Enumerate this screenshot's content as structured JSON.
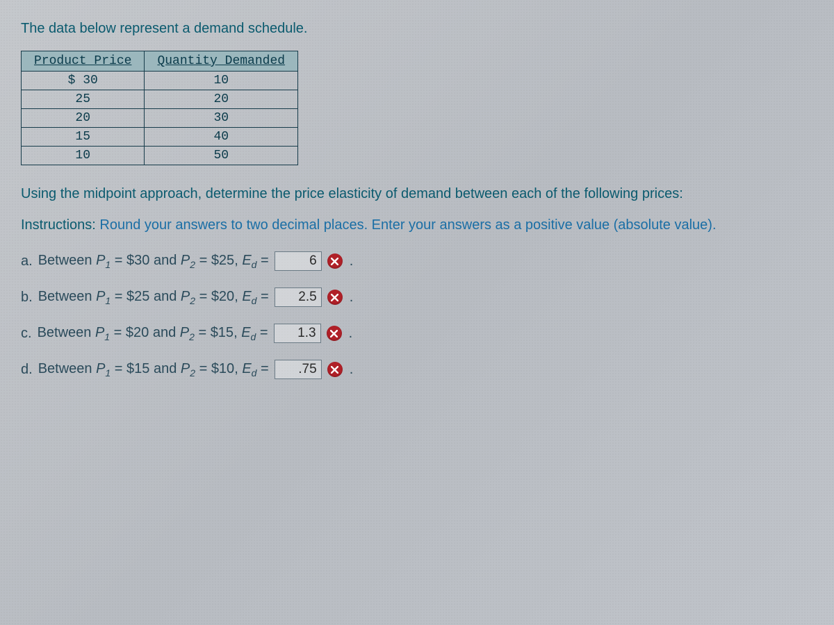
{
  "intro": "The data below represent a demand schedule.",
  "table": {
    "headers": [
      "Product Price",
      "Quantity Demanded"
    ],
    "rows": [
      [
        "$ 30",
        "10"
      ],
      [
        "25",
        "20"
      ],
      [
        "20",
        "30"
      ],
      [
        "15",
        "40"
      ],
      [
        "10",
        "50"
      ]
    ]
  },
  "paragraph": "Using the midpoint approach, determine the price elasticity of demand between each of the following prices:",
  "instructions_label": "Instructions:",
  "instructions_body": " Round your answers to two decimal places. Enter your answers as a positive value (absolute value).",
  "questions": [
    {
      "label": "a.",
      "p1": "$30",
      "p2": "$25",
      "value": "6"
    },
    {
      "label": "b.",
      "p1": "$25",
      "p2": "$20",
      "value": "2.5"
    },
    {
      "label": "c.",
      "p1": "$20",
      "p2": "$15",
      "value": "1.3"
    },
    {
      "label": "d.",
      "p1": "$15",
      "p2": "$10",
      "value": ".75"
    }
  ]
}
